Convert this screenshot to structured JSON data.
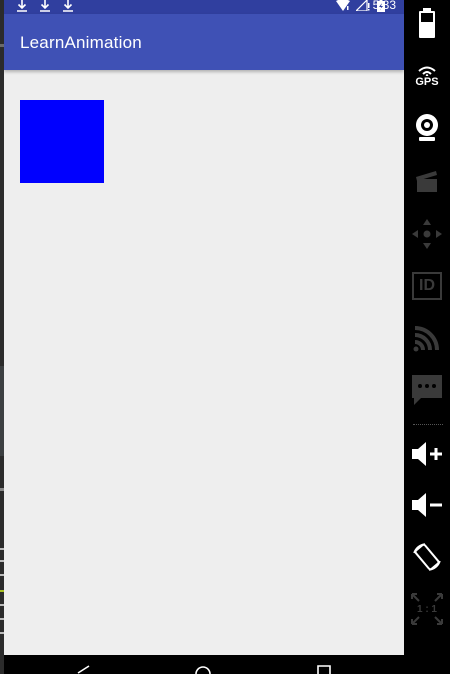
{
  "status_bar": {
    "time": "5:33",
    "icons": [
      "download-icon",
      "download-icon",
      "download-icon",
      "wifi-icon",
      "signal-icon",
      "battery-icon"
    ]
  },
  "app_bar": {
    "title": "LearnAnimation"
  },
  "content": {
    "square_color": "#0000ff"
  },
  "toolbar": {
    "items": [
      "battery",
      "gps",
      "camera",
      "media",
      "directional-pad",
      "id",
      "cast",
      "message",
      "volume-up",
      "volume-down",
      "rotate",
      "scale"
    ],
    "gps_label": "GPS",
    "id_label": "ID",
    "scale_label": "1 : 1"
  },
  "colors": {
    "primary": "#3f51b5",
    "primary_dark": "#303f9f",
    "background": "#eeeeee"
  }
}
